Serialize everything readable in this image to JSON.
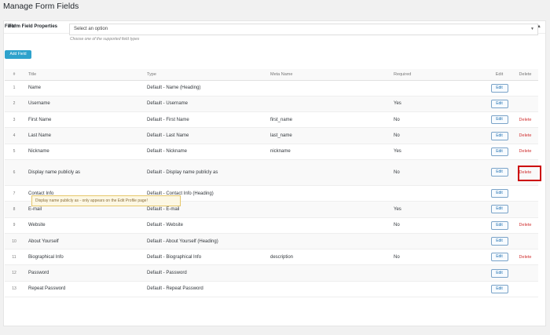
{
  "page": {
    "title": "Manage Form Fields"
  },
  "panel": {
    "title": "Form Field Properties",
    "toggle_icon": "triangle-up"
  },
  "form": {
    "field_label": "Field",
    "select_value": "Select an option",
    "hint": "Choose one of the supported field types",
    "add_button": "Add Field"
  },
  "table": {
    "headers": {
      "num": "#",
      "title": "Title",
      "type": "Type",
      "meta": "Meta Name",
      "required": "Required",
      "edit": "Edit",
      "delete": "Delete"
    },
    "edit_label": "Edit",
    "delete_label": "Delete",
    "rows": [
      {
        "num": "1",
        "title": "Name",
        "type": "Default - Name (Heading)",
        "meta": "",
        "required": "",
        "delete": false
      },
      {
        "num": "2",
        "title": "Username",
        "type": "Default - Username",
        "meta": "",
        "required": "Yes",
        "delete": false
      },
      {
        "num": "3",
        "title": "First Name",
        "type": "Default - First Name",
        "meta": "first_name",
        "required": "No",
        "delete": true
      },
      {
        "num": "4",
        "title": "Last Name",
        "type": "Default - Last Name",
        "meta": "last_name",
        "required": "No",
        "delete": true
      },
      {
        "num": "5",
        "title": "Nickname",
        "type": "Default - Nickname",
        "meta": "nickname",
        "required": "Yes",
        "delete": true
      },
      {
        "num": "6",
        "title": "Display name publicly as",
        "type": "Default - Display name publicly as",
        "meta": "",
        "required": "No",
        "delete": true
      },
      {
        "num": "7",
        "title": "Contact Info",
        "type": "Default - Contact Info (Heading)",
        "meta": "",
        "required": "",
        "delete": false
      },
      {
        "num": "8",
        "title": "E-mail",
        "type": "Default - E-mail",
        "meta": "",
        "required": "Yes",
        "delete": false
      },
      {
        "num": "9",
        "title": "Website",
        "type": "Default - Website",
        "meta": "",
        "required": "No",
        "delete": true
      },
      {
        "num": "10",
        "title": "About Yourself",
        "type": "Default - About Yourself (Heading)",
        "meta": "",
        "required": "",
        "delete": false
      },
      {
        "num": "11",
        "title": "Biographical Info",
        "type": "Default - Biographical Info",
        "meta": "description",
        "required": "No",
        "delete": true
      },
      {
        "num": "12",
        "title": "Password",
        "type": "Default - Password",
        "meta": "",
        "required": "",
        "delete": false
      },
      {
        "num": "13",
        "title": "Repeat Password",
        "type": "Default - Repeat Password",
        "meta": "",
        "required": "",
        "delete": false
      }
    ],
    "tooltip": "Display name publicly as - only appears on the Edit Profile page!"
  }
}
